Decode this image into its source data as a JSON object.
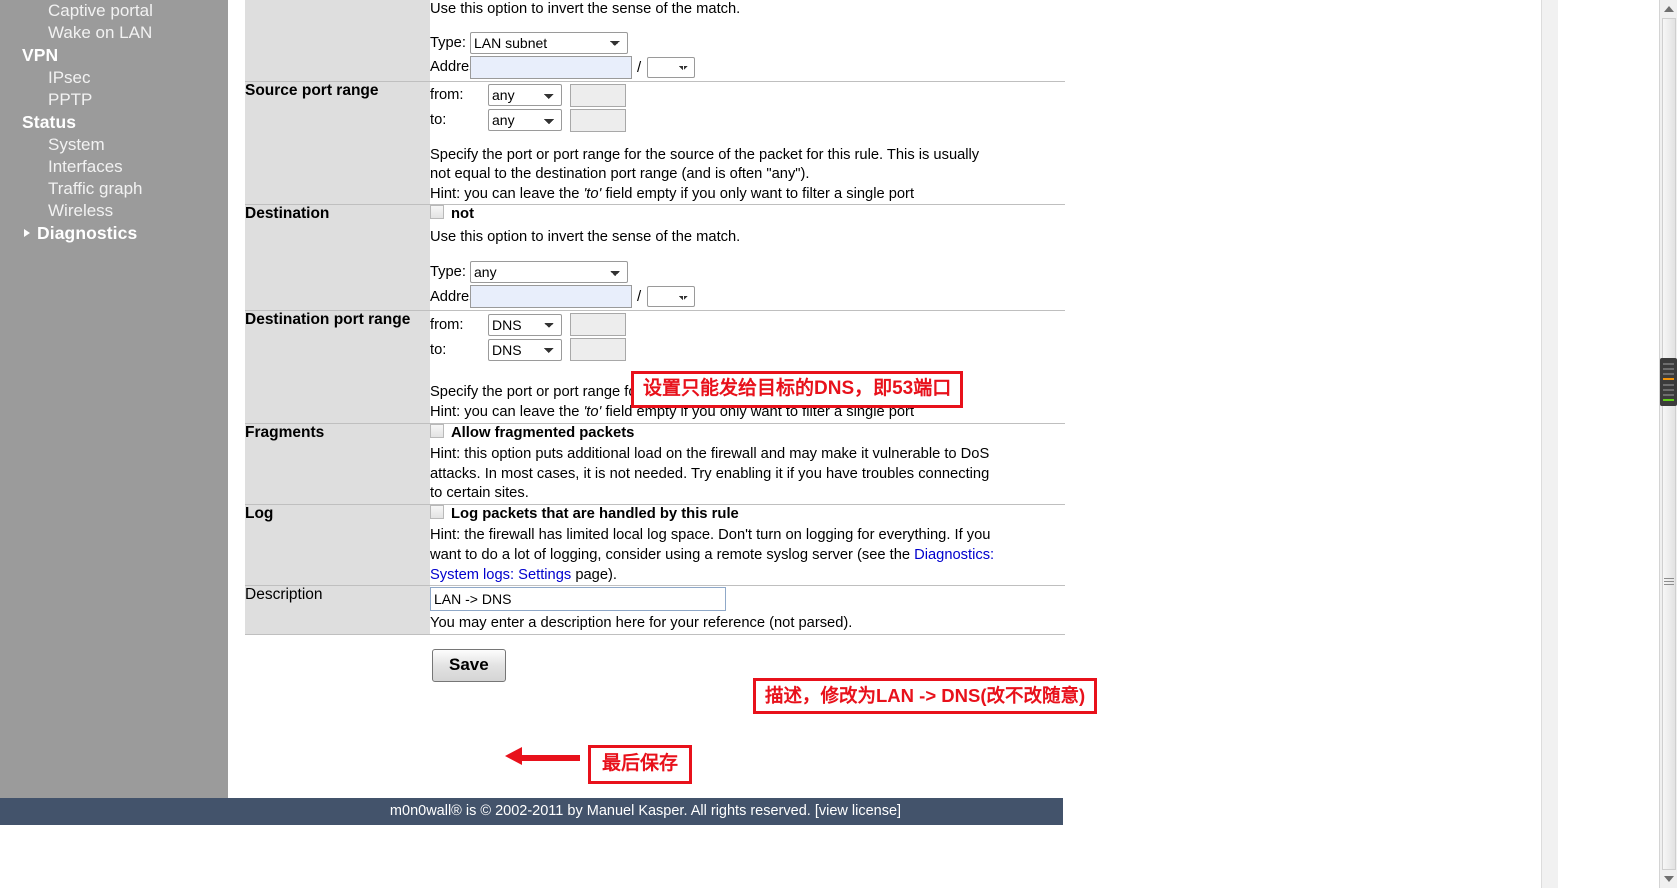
{
  "sidebar": {
    "items": [
      {
        "label": "Captive portal",
        "type": "item"
      },
      {
        "label": "Wake on LAN",
        "type": "item"
      },
      {
        "label": "VPN",
        "type": "group"
      },
      {
        "label": "IPsec",
        "type": "item"
      },
      {
        "label": "PPTP",
        "type": "item"
      },
      {
        "label": "Status",
        "type": "group"
      },
      {
        "label": "System",
        "type": "item"
      },
      {
        "label": "Interfaces",
        "type": "item"
      },
      {
        "label": "Traffic graph",
        "type": "item"
      },
      {
        "label": "Wireless",
        "type": "item"
      },
      {
        "label": "Diagnostics",
        "type": "group-arrow"
      }
    ]
  },
  "form": {
    "source": {
      "not_hint": "Use this option to invert the sense of the match.",
      "type_label": "Type:",
      "type_value": "LAN subnet",
      "address_label": "Address:",
      "address_value": "",
      "mask_value": ""
    },
    "source_port_range": {
      "label": "Source port range",
      "from_label": "from:",
      "from_value": "any",
      "from_custom": "",
      "to_label": "to:",
      "to_value": "any",
      "to_custom": "",
      "hint1": "Specify the port or port range for the source of the packet for this rule. This is usually",
      "hint2": "not equal to the destination port range (and is often \"any\").",
      "hint3_pre": "Hint: you can leave the ",
      "hint3_em": "'to'",
      "hint3_post": " field empty if you only want to filter a single port"
    },
    "destination": {
      "label": "Destination",
      "not_label": "not",
      "not_hint": "Use this option to invert the sense of the match.",
      "type_label": "Type:",
      "type_value": "any",
      "address_label": "Address:",
      "address_value": "",
      "mask_value": ""
    },
    "destination_port_range": {
      "label": "Destination port range",
      "from_label": "from:",
      "from_value": "DNS",
      "from_custom": "",
      "to_label": "to:",
      "to_value": "DNS",
      "to_custom": "",
      "hint1": "Specify the port or port range for the destination of the packet for this rule.",
      "hint2_pre": "Hint: you can leave the ",
      "hint2_em": "'to'",
      "hint2_post": " field empty if you only want to filter a single port"
    },
    "fragments": {
      "label": "Fragments",
      "checkbox_label": "Allow fragmented packets",
      "hint1": "Hint: this option puts additional load on the firewall and may make it vulnerable to DoS",
      "hint2": "attacks. In most cases, it is not needed. Try enabling it if you have troubles connecting",
      "hint3": "to certain sites."
    },
    "log": {
      "label": "Log",
      "checkbox_label": "Log packets that are handled by this rule",
      "hint1": "Hint: the firewall has limited local log space. Don't turn on logging for everything. If you",
      "hint2_pre": "want to do a lot of logging, consider using a remote syslog server (see the ",
      "hint2_link": "Diagnostics:",
      "hint3_link": "System logs: Settings",
      "hint3_post": " page)."
    },
    "description": {
      "label": "Description",
      "value": "LAN -> DNS",
      "hint": "You may enter a description here for your reference (not parsed)."
    },
    "save_label": "Save"
  },
  "annotations": {
    "dest_port": "设置只能发给目标的DNS，即53端口",
    "description": "描述，修改为LAN -> DNS(改不改随意)",
    "save": "最后保存"
  },
  "footer": {
    "text": "m0n0wall® is © 2002-2011 by Manuel Kasper. All rights reserved.  ",
    "license": "[view license]"
  },
  "colors": {
    "annotation_red": "#e8111b",
    "link_blue": "#0000cd",
    "sidebar_gray": "#9b9b9b",
    "footer_navy": "#43536b"
  }
}
